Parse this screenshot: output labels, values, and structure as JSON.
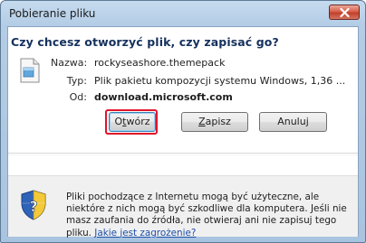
{
  "window": {
    "title": "Pobieranie pliku",
    "question": "Czy chcesz otworzyć plik, czy zapisać go?"
  },
  "file": {
    "name_label": "Nazwa:",
    "name_value": "rockyseashore.themepack",
    "type_label": "Typ:",
    "type_value": "Plik pakietu kompozycji systemu Windows, 1,36 ...",
    "from_label": "Od:",
    "from_value": "download.microsoft.com"
  },
  "buttons": {
    "open_prefix": "O",
    "open_ul": "t",
    "open_rest": "wórz",
    "save_prefix": "",
    "save_ul": "Z",
    "save_rest": "apisz",
    "cancel_label": "Anuluj"
  },
  "warning": {
    "text": "Pliki pochodzące z Internetu mogą być użyteczne, ale niektóre z nich mogą być szkodliwe dla komputera. Jeśli nie masz zaufania do źródła, nie otwieraj ani nie zapisuj tego pliku.",
    "link": "Jakie jest zagrożenie?"
  },
  "colors": {
    "highlight": "#e0152a",
    "heading": "#15315e",
    "link": "#1a4ea8"
  },
  "icons": [
    "close-icon",
    "file-icon",
    "shield-icon"
  ]
}
